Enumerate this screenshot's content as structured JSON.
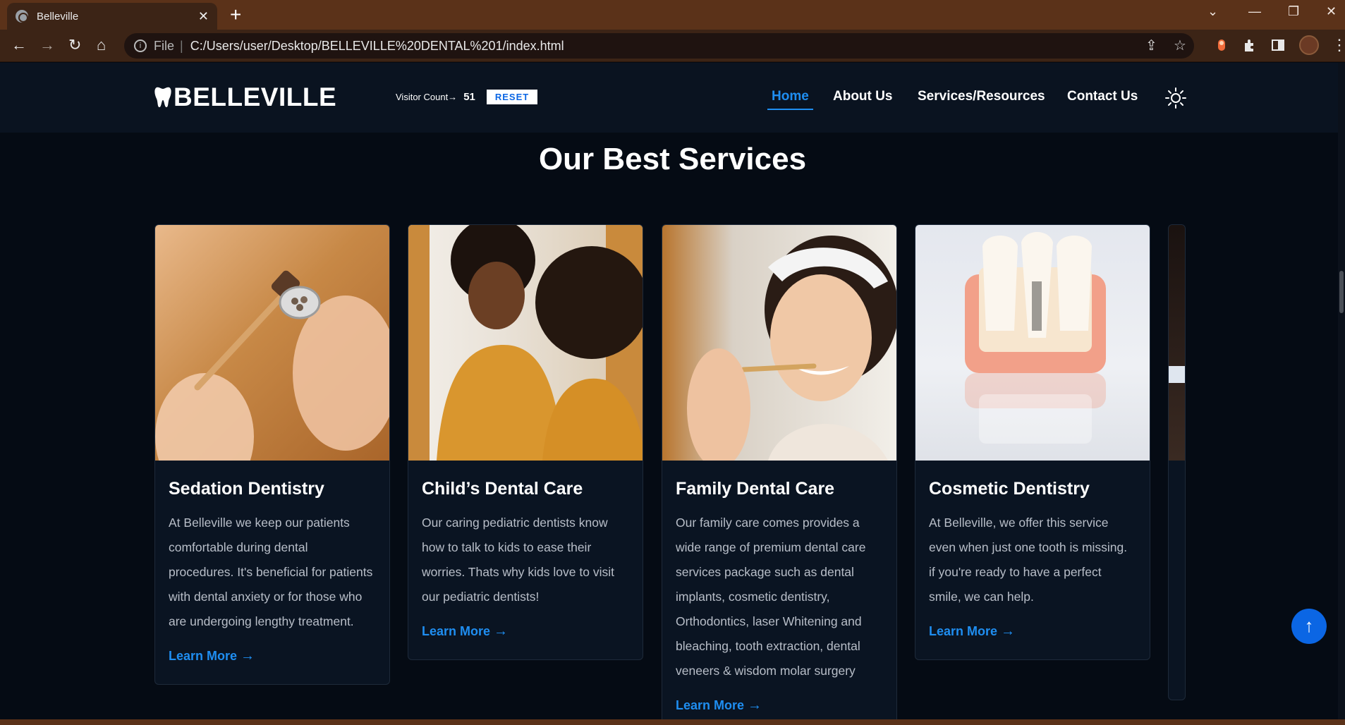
{
  "browser": {
    "tab_title": "Belleville",
    "new_tab": "+",
    "scheme": "File",
    "url": "C:/Users/user/Desktop/BELLEVILLE%20DENTAL%201/index.html"
  },
  "site": {
    "logo": "BELLEVILLE",
    "visitor_label": "Visitor Count→",
    "visitor_count": "51",
    "reset_label": "RESET",
    "nav": {
      "home": "Home",
      "about": "About Us",
      "services": "Services/Resources",
      "contact": "Contact Us"
    }
  },
  "section": {
    "title_light": "Our Best",
    "title_bold": "Services"
  },
  "cards": [
    {
      "title": "Sedation Dentistry",
      "text": "At Belleville we keep our patients comfortable during dental procedures. It's beneficial for patients with dental anxiety or for those who are undergoing lengthy treatment.",
      "link": "Learn More"
    },
    {
      "title": "Child’s Dental Care",
      "text": "Our caring pediatric dentists know how to talk to kids to ease their worries. Thats why kids love to visit our pediatric dentists!",
      "link": "Learn More"
    },
    {
      "title": "Family Dental Care",
      "text": "Our family care comes provides a wide range of premium dental care services package such as dental implants, cosmetic dentistry, Orthodontics, laser Whitening and bleaching, tooth extraction, dental veneers & wisdom molar surgery",
      "link": "Learn More"
    },
    {
      "title": "Cosmetic Dentistry",
      "text": "At Belleville, we offer this service even when just one tooth is missing. if you're ready to have a perfect smile, we can help.",
      "link": "Learn More"
    }
  ],
  "colors": {
    "accent": "#1f8ef1",
    "page_bg": "#050b14",
    "browser_frame": "#5b3219"
  }
}
